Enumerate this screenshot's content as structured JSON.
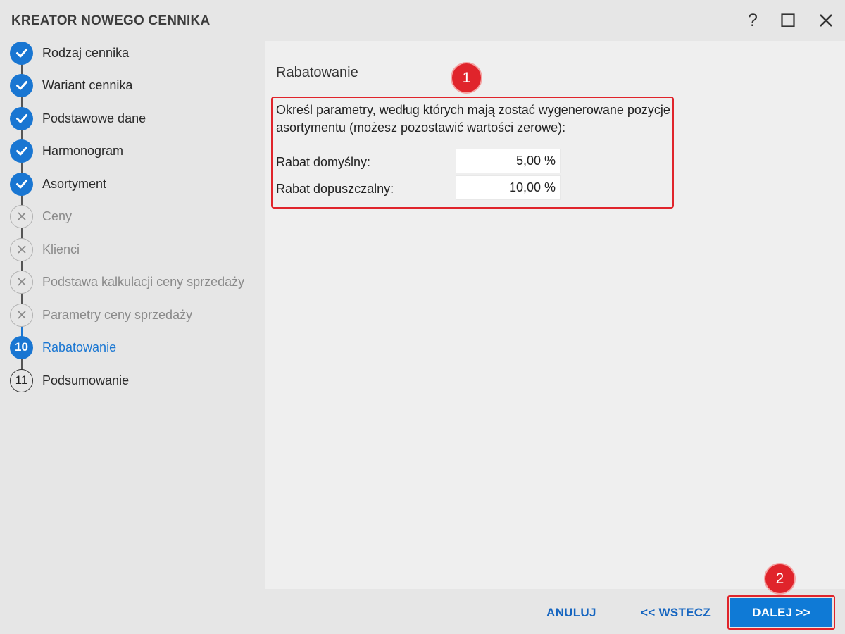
{
  "window": {
    "title": "KREATOR NOWEGO CENNIKA",
    "help_label": "?"
  },
  "steps": [
    {
      "label": "Rodzaj cennika",
      "state": "done"
    },
    {
      "label": "Wariant cennika",
      "state": "done"
    },
    {
      "label": "Podstawowe dane",
      "state": "done"
    },
    {
      "label": "Harmonogram",
      "state": "done"
    },
    {
      "label": "Asortyment",
      "state": "done"
    },
    {
      "label": "Ceny",
      "state": "skipped"
    },
    {
      "label": "Klienci",
      "state": "skipped"
    },
    {
      "label": "Podstawa kalkulacji ceny sprzedaży",
      "state": "skipped"
    },
    {
      "label": "Parametry ceny sprzedaży",
      "state": "skipped"
    },
    {
      "label": "Rabatowanie",
      "state": "current",
      "number": "10"
    },
    {
      "label": "Podsumowanie",
      "state": "todo",
      "number": "11"
    }
  ],
  "main": {
    "section_title": "Rabatowanie",
    "description": "Określ parametry, według których mają zostać wygenerowane pozycje asortymentu (możesz pozostawić wartości zerowe):",
    "fields": [
      {
        "label": "Rabat domyślny:",
        "value": "5,00 %"
      },
      {
        "label": "Rabat dopuszczalny:",
        "value": "10,00 %"
      }
    ]
  },
  "annotations": {
    "badge_1": "1",
    "badge_2": "2"
  },
  "footer": {
    "cancel_label": "ANULUJ",
    "back_label": "<< WSTECZ",
    "next_label": "DALEJ >>"
  },
  "colors": {
    "accent": "#1976d2",
    "primary_button": "#0f7ad6",
    "annotation_red": "#e0242b"
  }
}
